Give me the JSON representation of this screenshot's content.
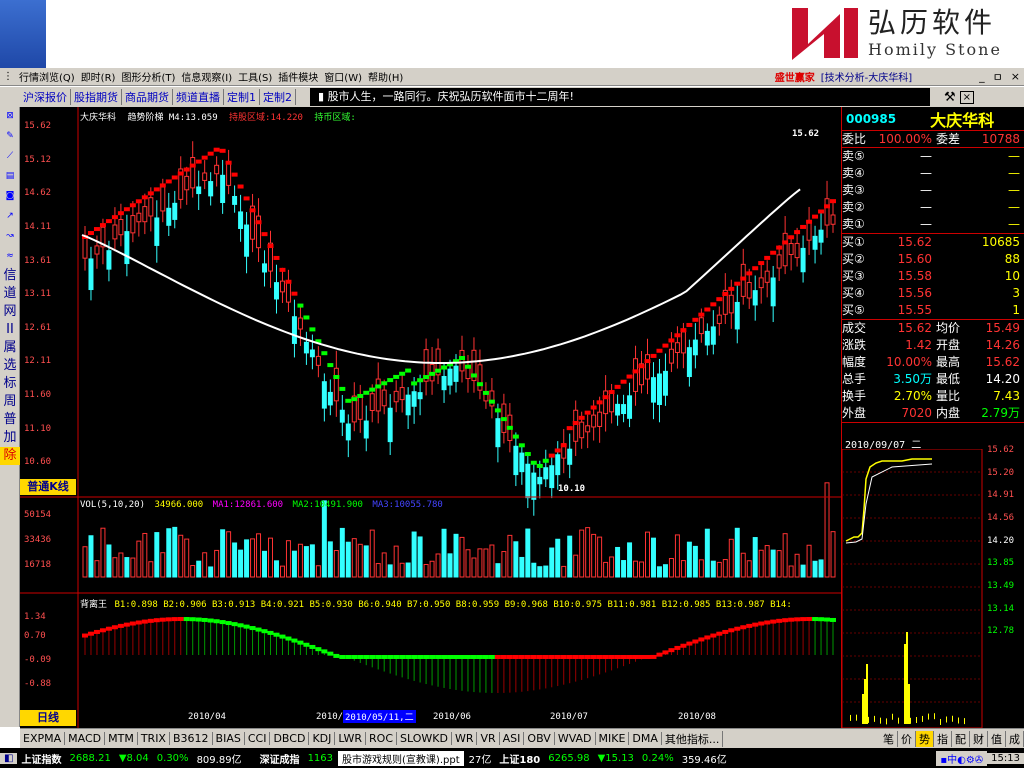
{
  "logo": {
    "cn": "弘历软件",
    "en": "Homily Stone"
  },
  "menu": {
    "items": [
      "行情浏览(Q)",
      "即时(R)",
      "图形分析(T)",
      "信息观察(I)",
      "工具(S)",
      "插件模块",
      "窗口(W)",
      "帮助(H)"
    ],
    "brand": "盛世赢家",
    "window_title": "[技术分析-大庆华科]",
    "win_buttons": [
      "_",
      "ㅁ",
      "×"
    ]
  },
  "tabs": [
    "沪深报价",
    "股指期货",
    "商品期货",
    "频道直播",
    "定制1",
    "定制2"
  ],
  "ticker_text": "股市人生，一路同行。庆祝弘历软件面市十二周年!",
  "left_tools": {
    "vertical_labels": [
      "信",
      "道",
      "网",
      "II",
      "属",
      "选",
      "标",
      "周",
      "普",
      "加",
      "除"
    ],
    "selected": "除"
  },
  "main_chart": {
    "title": "大庆华科",
    "indicator": "趋势阶梯 M4:13.059",
    "hold_label": "持股区域:14.220",
    "coin_label": "持币区域:",
    "y_ticks": [
      "15.62",
      "15.12",
      "14.62",
      "14.11",
      "13.61",
      "13.11",
      "12.61",
      "12.11",
      "11.60",
      "11.10",
      "10.60"
    ],
    "high_label": "15.62",
    "low_label": "10.10",
    "chart_type_label": "普通K线"
  },
  "volume_chart": {
    "title": "VOL(5,10,20)",
    "value": "34966.000",
    "ma1": "MA1:12861.600",
    "ma2": "MA2:10491.900",
    "ma3": "MA3:10055.780",
    "y_ticks": [
      "50154",
      "33436",
      "16718"
    ]
  },
  "indicator_chart": {
    "title": "背离王",
    "values": "B1:0.898 B2:0.906 B3:0.913 B4:0.921 B5:0.930 B6:0.940 B7:0.950 B8:0.959 B9:0.968 B10:0.975 B11:0.981 B12:0.985 B13:0.987 B14:",
    "y_ticks": [
      "1.34",
      "0.70",
      "-0.09",
      "-0.88"
    ],
    "period_label": "日线"
  },
  "x_axis": [
    "2010/04",
    "2010/05",
    "2010/05/11,二",
    "2010/06",
    "2010/07",
    "2010/08"
  ],
  "quote": {
    "code": "000985",
    "name": "大庆华科",
    "webi": {
      "label": "委比",
      "value": "100.00%",
      "label2": "委差",
      "value2": "10788"
    },
    "sell": [
      {
        "label": "卖⑤",
        "price": "—",
        "vol": "—"
      },
      {
        "label": "卖④",
        "price": "—",
        "vol": "—"
      },
      {
        "label": "卖③",
        "price": "—",
        "vol": "—"
      },
      {
        "label": "卖②",
        "price": "—",
        "vol": "—"
      },
      {
        "label": "卖①",
        "price": "—",
        "vol": "—"
      }
    ],
    "buy": [
      {
        "label": "买①",
        "price": "15.62",
        "vol": "10685"
      },
      {
        "label": "买②",
        "price": "15.60",
        "vol": "88"
      },
      {
        "label": "买③",
        "price": "15.58",
        "vol": "10"
      },
      {
        "label": "买④",
        "price": "15.56",
        "vol": "3"
      },
      {
        "label": "买⑤",
        "price": "15.55",
        "vol": "1"
      }
    ],
    "stats": [
      {
        "l1": "成交",
        "v1": "15.62",
        "l2": "均价",
        "v2": "15.49"
      },
      {
        "l1": "涨跌",
        "v1": "1.42",
        "l2": "开盘",
        "v2": "14.26"
      },
      {
        "l1": "幅度",
        "v1": "10.00%",
        "l2": "最高",
        "v2": "15.62"
      },
      {
        "l1": "总手",
        "v1": "3.50万",
        "l2": "最低",
        "v2": "14.20"
      },
      {
        "l1": "换手",
        "v1": "2.70%",
        "l2": "量比",
        "v2": "7.43"
      },
      {
        "l1": "外盘",
        "v1": "7020",
        "l2": "内盘",
        "v2": "2.79万"
      }
    ]
  },
  "mini_chart": {
    "date": "2010/09/07 二",
    "y_ticks": [
      "15.62",
      "15.20",
      "14.91",
      "14.56",
      "14.20",
      "13.85",
      "13.49",
      "13.14",
      "12.78"
    ]
  },
  "right_tabs": [
    "笔",
    "价",
    "势",
    "指",
    "配",
    "财",
    "值",
    "成"
  ],
  "bottom_tabs": [
    "EXPMA",
    "MACD",
    "MTM",
    "TRIX",
    "B3612",
    "BIAS",
    "CCI",
    "DBCD",
    "KDJ",
    "LWR",
    "ROC",
    "SLOWKD",
    "WR",
    "VR",
    "ASI",
    "OBV",
    "WVAD",
    "MIKE",
    "DMA",
    "其他指标..."
  ],
  "status": {
    "sh_label": "上证指数",
    "sh_value": "2688.21",
    "sh_change": "▼8.04",
    "sh_pct": "0.30%",
    "sh_amount": "809.89亿",
    "sz_label": "深证成指",
    "sz_value": "1163",
    "popup": "股市游戏规则(宣教课).ppt",
    "amount2": "27亿",
    "s180_label": "上证180",
    "s180_value": "6265.98",
    "s180_change": "▼15.13",
    "s180_pct": "0.24%",
    "s180_amount": "359.46亿",
    "time": "15:13"
  }
}
